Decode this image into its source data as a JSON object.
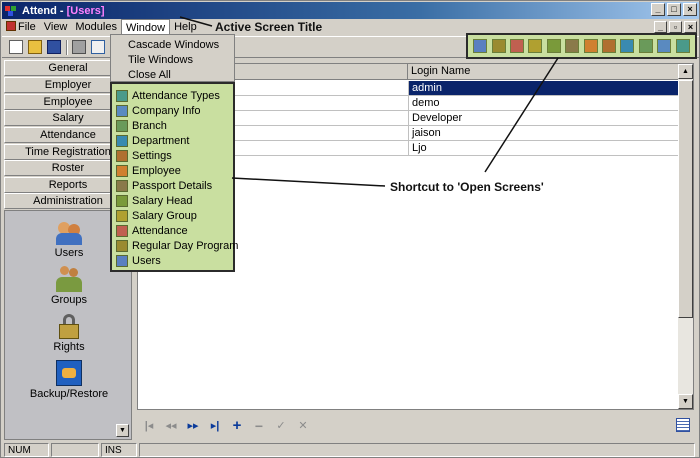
{
  "window": {
    "title_app": "Attend - ",
    "title_screen": "[Users]",
    "buttons": [
      "_",
      "□",
      "×"
    ]
  },
  "menubar": {
    "items": [
      "File",
      "View",
      "Modules",
      "Window",
      "Help"
    ],
    "mdi_buttons": [
      "_",
      "▫",
      "×"
    ]
  },
  "window_menu": {
    "items": [
      "Cascade Windows",
      "Tile Windows",
      "Close All"
    ],
    "open_screens": [
      {
        "label": "Attendance Types",
        "color": "#4a9a8a"
      },
      {
        "label": "Company Info",
        "color": "#5a8ac0"
      },
      {
        "label": "Branch",
        "color": "#6a9a5a"
      },
      {
        "label": "Department",
        "color": "#3a8ab0"
      },
      {
        "label": "Settings",
        "color": "#b07030"
      },
      {
        "label": "Employee",
        "color": "#d08030"
      },
      {
        "label": "Passport Details",
        "color": "#8a7a4a"
      },
      {
        "label": "Salary Head",
        "color": "#7a9a3a"
      },
      {
        "label": "Salary Group",
        "color": "#b0a030"
      },
      {
        "label": "Attendance",
        "color": "#c06050"
      },
      {
        "label": "Regular Day Program",
        "color": "#9a8a30"
      },
      {
        "label": "Users",
        "color": "#5a80c0"
      }
    ]
  },
  "leftnav": {
    "groups": [
      "General",
      "Employer",
      "Employee",
      "Salary",
      "Attendance",
      "Time Registration",
      "Roster",
      "Reports",
      "Administration"
    ],
    "tools": [
      {
        "label": "Users"
      },
      {
        "label": "Groups"
      },
      {
        "label": "Rights"
      },
      {
        "label": "Backup/Restore"
      }
    ]
  },
  "grid": {
    "columns": [
      "",
      "Login Name"
    ],
    "rows": [
      {
        "login": "admin",
        "selected": true
      },
      {
        "login": "demo",
        "selected": false
      },
      {
        "login": "Developer",
        "selected": false
      },
      {
        "login": "jaison",
        "selected": false
      },
      {
        "login": "Ljo",
        "selected": false
      }
    ]
  },
  "navigator": {
    "controls": [
      {
        "name": "first-record",
        "glyph": "|◂",
        "enabled": false
      },
      {
        "name": "prior-record",
        "glyph": "◂◂",
        "enabled": false
      },
      {
        "name": "next-record",
        "glyph": "▸▸",
        "enabled": true
      },
      {
        "name": "last-record",
        "glyph": "▸|",
        "enabled": true
      },
      {
        "name": "insert-record",
        "glyph": "+",
        "enabled": true
      },
      {
        "name": "delete-record",
        "glyph": "−",
        "enabled": false
      },
      {
        "name": "post-edit",
        "glyph": "✓",
        "enabled": false
      },
      {
        "name": "cancel-edit",
        "glyph": "✕",
        "enabled": false
      }
    ]
  },
  "statusbar": {
    "panes": [
      "NUM",
      "",
      "INS",
      ""
    ]
  },
  "annotations": {
    "active_title": "Active Screen Title",
    "shortcut": "Shortcut to 'Open Screens'"
  },
  "colors": {
    "titlebar": "#0a246a",
    "highlight_green": "#c9dfa0",
    "selected_row": "#0a246a"
  }
}
